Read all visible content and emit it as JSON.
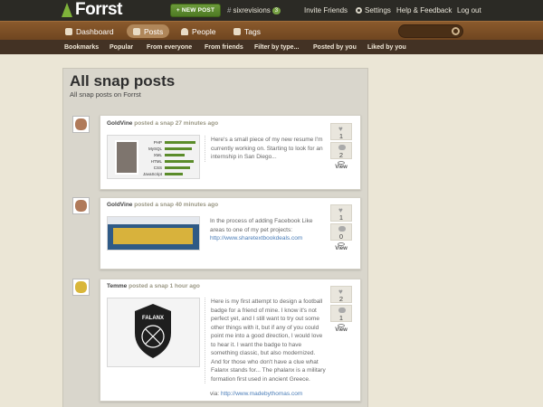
{
  "topbar": {
    "logo": "Forrst",
    "new_post": "+ NEW POST",
    "username": "sixrevisions",
    "count": "3",
    "invite": "Invite Friends",
    "settings": "Settings",
    "help": "Help & Feedback",
    "logout": "Log out"
  },
  "tabs": {
    "dashboard": "Dashboard",
    "posts": "Posts",
    "people": "People",
    "tags": "Tags"
  },
  "subnav": [
    "Bookmarks",
    "Popular",
    "From everyone",
    "From friends",
    "Filter by type...",
    "Posted by you",
    "Liked by you"
  ],
  "page": {
    "title": "All snap posts",
    "subtitle": "All snap posts on Forrst"
  },
  "posts": [
    {
      "user": "GoldVine",
      "verb": "posted a snap",
      "time": "27 minutes ago",
      "description": "Here's a small piece of my new resume I'm currently working on. Starting to look for an internship in San Diego...",
      "likes": "1",
      "comments": "2",
      "view": "View",
      "skills": [
        "PHP",
        "MySQL",
        "XML",
        "HTML",
        "CSS",
        "JavaScript"
      ]
    },
    {
      "user": "GoldVine",
      "verb": "posted a snap",
      "time": "40 minutes ago",
      "description": "In the process of adding Facebook Like areas to one of my pet projects:",
      "link": "http://www.sharetextbookdeals.com",
      "likes": "1",
      "comments": "0",
      "view": "View"
    },
    {
      "user": "Temme",
      "verb": "posted a snap",
      "time": "1 hour ago",
      "description": "Here is my first attempt to design a football badge for a friend of mine. I know it's not perfect yet, and I still want to try out some other things with it, but if any of you could point me into a good direction, I would love to hear it. I want the badge to have something classic, but also modernized. And for those who don't have a clue what Falanx stands for... The phalanx is a military formation first used in ancient Greece.",
      "via": "via:",
      "link": "http://www.madebythomas.com",
      "badge_text": "FALANX",
      "likes": "2",
      "comments": "1",
      "view": "View"
    }
  ],
  "colors": {
    "accent": "#5b8c2a",
    "wood": "#7a4f25",
    "topbar": "#2b2a25"
  }
}
